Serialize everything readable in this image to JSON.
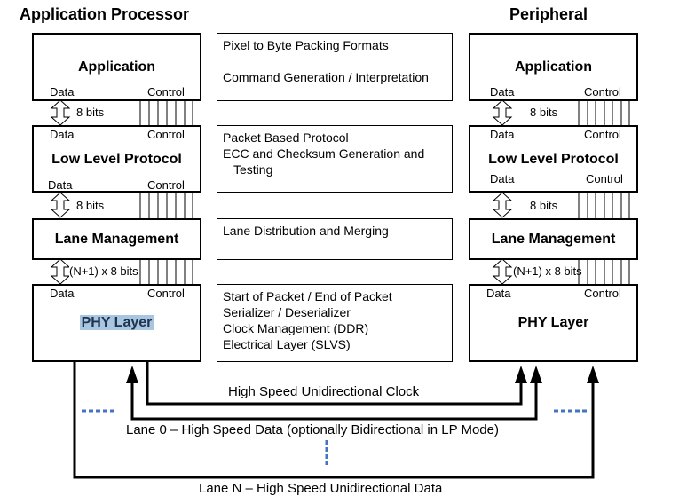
{
  "headers": {
    "left": "Application Processor",
    "right": "Peripheral"
  },
  "ports": {
    "data": "Data",
    "control": "Control"
  },
  "layers": [
    {
      "id": "application",
      "name": "Application"
    },
    {
      "id": "low-level-protocol",
      "name": "Low Level Protocol"
    },
    {
      "id": "lane-management",
      "name": "Lane Management"
    },
    {
      "id": "phy-layer",
      "name": "PHY Layer",
      "left_highlighted": true
    }
  ],
  "interfaces": [
    {
      "between": "application / low-level-protocol",
      "data_width": "8 bits"
    },
    {
      "between": "low-level-protocol / lane-management",
      "data_width": "8 bits"
    },
    {
      "between": "lane-management / phy-layer",
      "data_width": "(N+1) x 8 bits"
    }
  ],
  "descriptions": [
    {
      "layer": "application",
      "lines": [
        "Pixel to Byte Packing Formats",
        "",
        "Command Generation / Interpretation"
      ]
    },
    {
      "layer": "low-level-protocol",
      "lines": [
        "Packet Based Protocol",
        "ECC and Checksum Generation and",
        "  Testing"
      ]
    },
    {
      "layer": "lane-management",
      "lines": [
        "Lane Distribution and Merging"
      ]
    },
    {
      "layer": "phy-layer",
      "lines": [
        "Start of Packet / End of Packet",
        "Serializer / Deserializer",
        "Clock Management (DDR)",
        "Electrical Layer (SLVS)"
      ]
    }
  ],
  "signals": [
    {
      "id": "clock",
      "label": "High Speed Unidirectional Clock",
      "direction": "processor-to-peripheral"
    },
    {
      "id": "lane0",
      "label": "Lane 0 – High Speed Data (optionally Bidirectional in LP Mode)",
      "direction": "bidirectional"
    },
    {
      "id": "laneN",
      "label": "Lane N – High Speed Unidirectional Data",
      "direction": "processor-to-peripheral"
    }
  ],
  "colors": {
    "ellipsis": "#4472c4",
    "highlight": "#a9c6e0",
    "line": "#000000"
  }
}
